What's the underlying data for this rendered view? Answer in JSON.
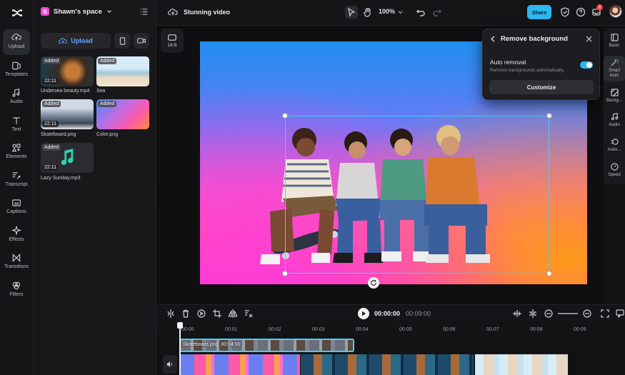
{
  "app": {
    "logo_icon": "capcut-logo-icon"
  },
  "sidebar": {
    "items": [
      {
        "label": "Upload",
        "icon": "upload-cloud-icon",
        "active": true
      },
      {
        "label": "Templates",
        "icon": "templates-icon"
      },
      {
        "label": "Audio",
        "icon": "music-note-icon"
      },
      {
        "label": "Text",
        "icon": "text-icon"
      },
      {
        "label": "Elements",
        "icon": "elements-icon"
      },
      {
        "label": "Transcript",
        "icon": "transcript-icon"
      },
      {
        "label": "Captions",
        "icon": "captions-icon"
      },
      {
        "label": "Effects",
        "icon": "sparkle-icon"
      },
      {
        "label": "Transitions",
        "icon": "transitions-icon"
      },
      {
        "label": "Filters",
        "icon": "filters-icon"
      }
    ]
  },
  "space": {
    "badge": "S",
    "name": "Shawn's space"
  },
  "media": {
    "upload_label": "Upload",
    "items": [
      {
        "name": "Undersea beauty.mp4",
        "status": "Added",
        "duration": "22:11"
      },
      {
        "name": "Sea",
        "status": "Added",
        "duration": ""
      },
      {
        "name": "Skateboard.png",
        "status": "Added",
        "duration": "22:11"
      },
      {
        "name": "Color.png",
        "status": "Added",
        "duration": ""
      },
      {
        "name": "Lazy Sunday.mp3",
        "status": "Added",
        "duration": "22:11"
      }
    ]
  },
  "topbar": {
    "project_title": "Stunning video",
    "zoom": "100%",
    "share_label": "Share",
    "notification_count": "8"
  },
  "canvas": {
    "ratio_label": "16:9"
  },
  "popup": {
    "title": "Remove background",
    "auto_removal_label": "Auto removal",
    "auto_removal_desc": "Remove backgrounds automatically.",
    "auto_removal_on": true,
    "customize_label": "Customize"
  },
  "right_panel": {
    "items": [
      {
        "label": "Basic",
        "icon": "basic-icon"
      },
      {
        "label": "Smart tools",
        "icon": "magic-wand-icon",
        "active": true
      },
      {
        "label": "Backg...",
        "icon": "background-icon"
      },
      {
        "label": "Audio",
        "icon": "music-note-icon"
      },
      {
        "label": "Anim...",
        "icon": "animation-icon"
      },
      {
        "label": "Speed",
        "icon": "speed-icon"
      }
    ]
  },
  "timeline": {
    "current_time": "00:00:00",
    "total_time": "00:09:00",
    "ruler": [
      "00:00",
      "00:01",
      "00:02",
      "00:03",
      "00:04",
      "00:05",
      "00:06",
      "00:07",
      "00:08",
      "00:09"
    ],
    "clip_label": "Skateboard.png",
    "clip_duration": "00:04:00"
  }
}
